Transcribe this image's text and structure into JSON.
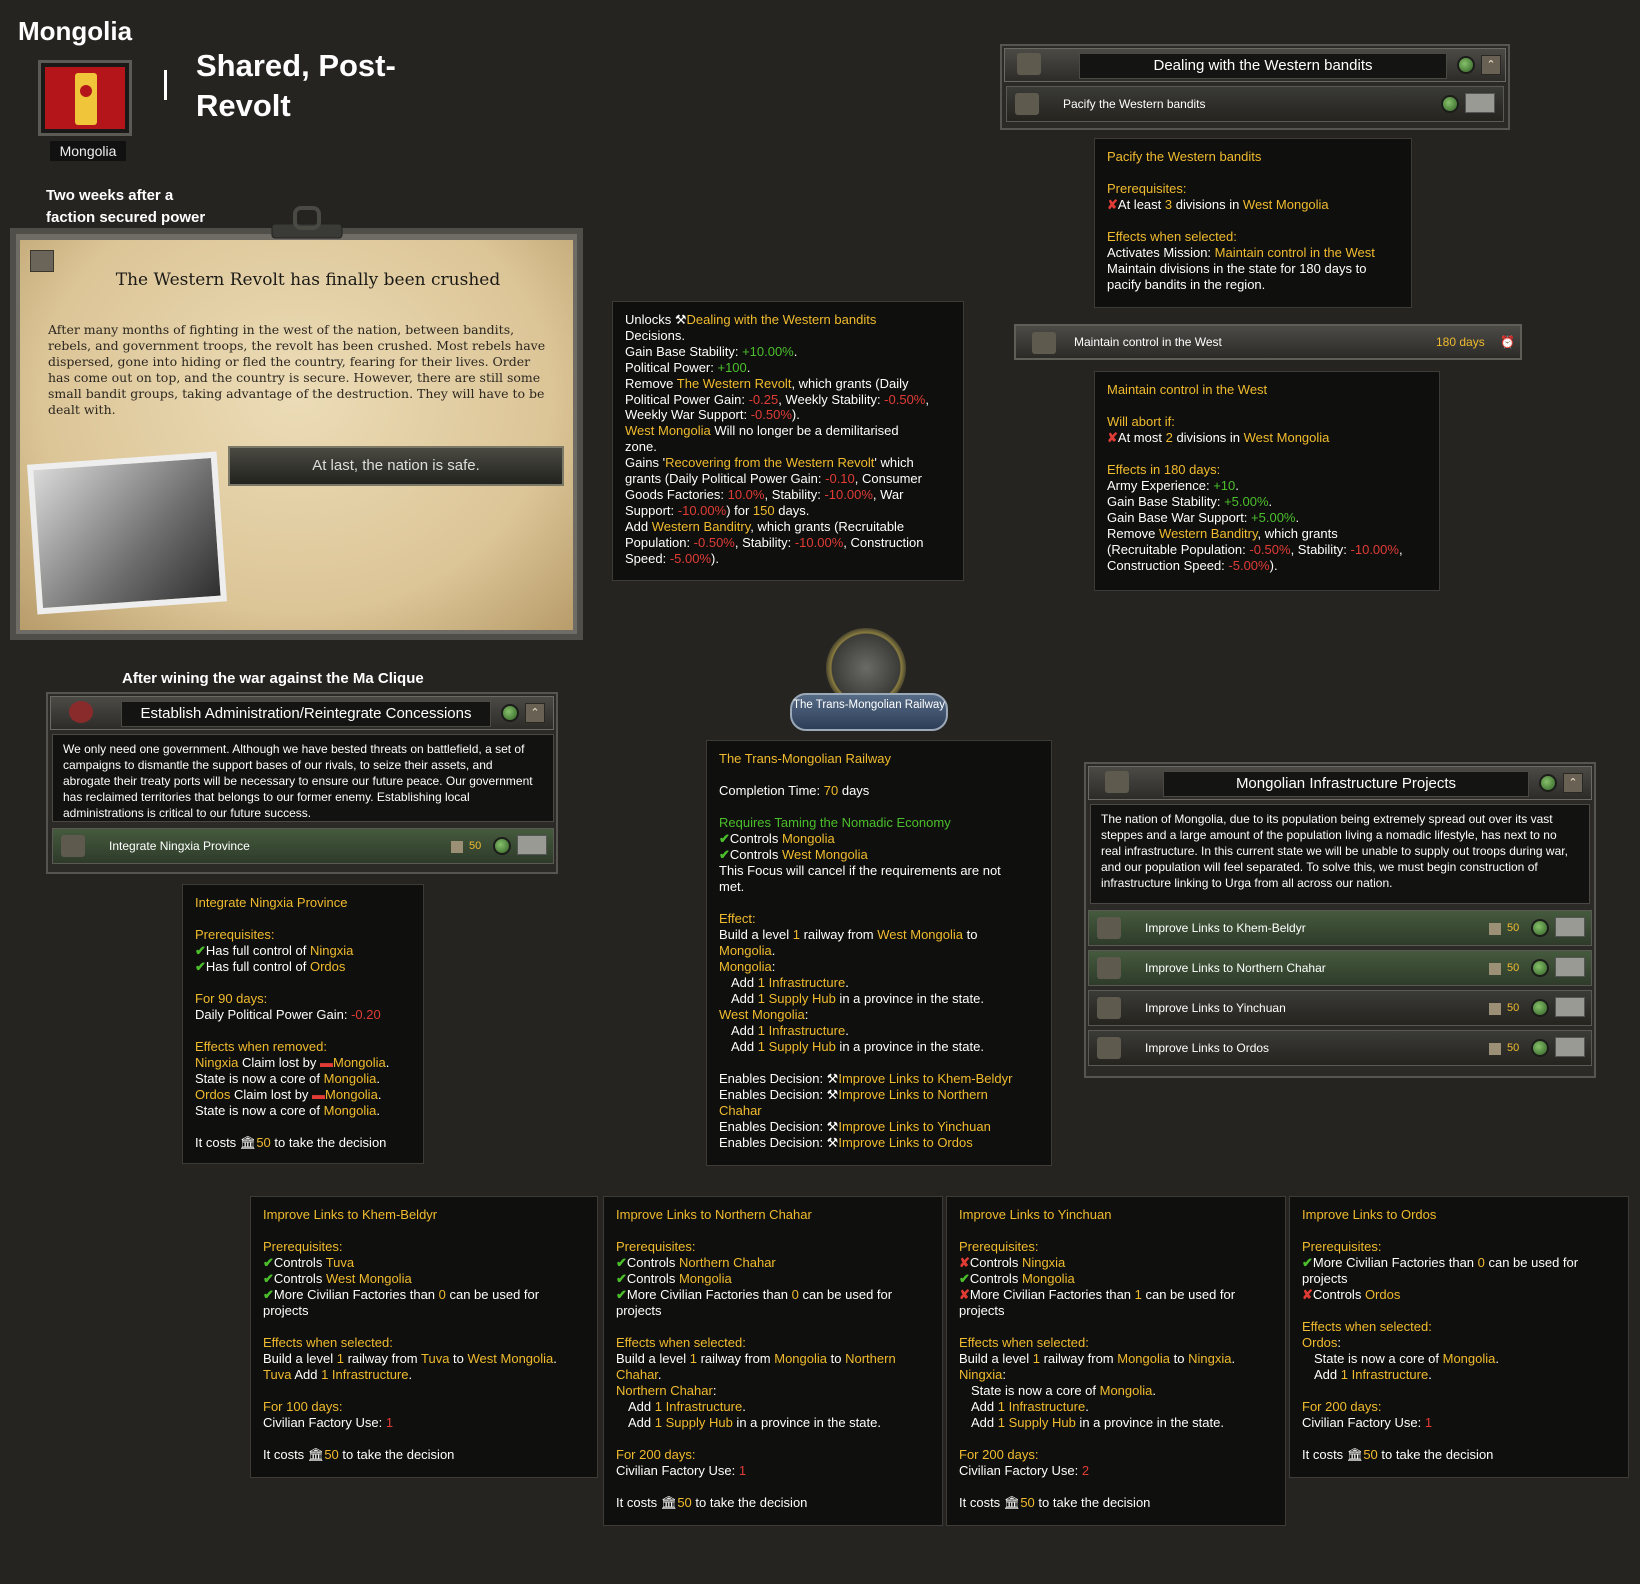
{
  "header": {
    "country": "Mongolia",
    "flag_label": "Mongolia",
    "separator": "|",
    "path_title": "Shared, Post-Revolt",
    "flag_colors": [
      "#b3151b",
      "#f1c53a"
    ]
  },
  "event": {
    "caption": "Two weeks after a faction secured power",
    "title": "The Western Revolt has finally been crushed",
    "text": "After many months of fighting in the west of the nation, between bandits, rebels, and government troops, the revolt has been crushed. Most rebels have dispersed, gone into hiding or fled the country, fearing for their lives. Order has come out on top, and the country is secure. However, there are still some small bandit groups, taking advantage of the destruction. They will have to be dealt with.",
    "option": "At last, the nation is safe."
  },
  "event_tooltip": {
    "l1a": "Unlocks ",
    "l1b": "Dealing with the Western bandits",
    "l2": "Decisions.",
    "l3a": "Gain Base Stability: ",
    "l3b": "+10.00%",
    "l3c": ".",
    "l4a": "Political Power: ",
    "l4b": "+100",
    "l4c": ".",
    "l5a": "Remove ",
    "l5b": "The Western Revolt",
    "l5c": ", which grants (Daily",
    "l6a": "Political Power Gain: ",
    "l6b": "-0.25",
    "l6c": ", Weekly Stability: ",
    "l6d": "-0.50%",
    "l6e": ",",
    "l7a": "Weekly War Support: ",
    "l7b": "-0.50%",
    "l7c": ").",
    "l8a": "West Mongolia",
    "l8b": " Will no longer be a demilitarised",
    "l9": "zone.",
    "l10a": "Gains '",
    "l10b": "Recovering from the Western Revolt",
    "l10c": "' which",
    "l11a": "grants (Daily Political Power Gain: ",
    "l11b": "-0.10",
    "l11c": ", Consumer",
    "l12a": "Goods Factories: ",
    "l12b": "10.0%",
    "l12c": ", Stability: ",
    "l12d": "-10.00%",
    "l12e": ", War",
    "l13a": "Support: ",
    "l13b": "-10.00%",
    "l13c": ") for ",
    "l13d": "150",
    "l13e": " days.",
    "l14a": "Add ",
    "l14b": "Western Banditry",
    "l14c": ", which grants (Recruitable",
    "l15a": "Population: ",
    "l15b": "-0.50%",
    "l15c": ", Stability: ",
    "l15d": "-10.00%",
    "l15e": ", Construction",
    "l16a": "Speed: ",
    "l16b": "-5.00%",
    "l16c": ")."
  },
  "bandits_panel": {
    "title": "Dealing with the Western bandits",
    "row": "Pacify the Western bandits"
  },
  "pacify_tt": {
    "title": "Pacify the Western bandits",
    "prereq": "Prerequisites:",
    "p1a": "At least ",
    "p1b": "3",
    "p1c": " divisions in ",
    "p1d": "West Mongolia",
    "eff": "Effects when selected:",
    "e1a": "Activates Mission: ",
    "e1b": "Maintain control in the West",
    "e2": "Maintain divisions in the state for 180 days to",
    "e3": "pacify bandits in the region."
  },
  "mission": {
    "label": "Maintain control in the West",
    "days": "180 days"
  },
  "maintain_tt": {
    "title": "Maintain control in the West",
    "abort": "Will abort if:",
    "a1a": "At most ",
    "a1b": "2",
    "a1c": " divisions in ",
    "a1d": "West Mongolia",
    "eff": "Effects in 180 days:",
    "e1a": "Army Experience: ",
    "e1b": "+10",
    "e1c": ".",
    "e2a": "Gain Base Stability: ",
    "e2b": "+5.00%",
    "e2c": ".",
    "e3a": "Gain Base War Support: ",
    "e3b": "+5.00%",
    "e3c": ".",
    "e4a": "Remove ",
    "e4b": "Western Banditry",
    "e4c": ", which grants",
    "e5a": "(Recruitable Population: ",
    "e5b": "-0.50%",
    "e5c": ", Stability: ",
    "e5d": "-10.00%",
    "e5e": ",",
    "e6a": "Construction Speed: ",
    "e6b": "-5.00%",
    "e6c": ")."
  },
  "admin": {
    "caption": "After wining the war against the Ma Clique",
    "title": "Establish Administration/Reintegrate Concessions",
    "desc": "We only need one government. Although we have bested threats on battlefield, a set of campaigns to dismantle the support bases of our rivals, to seize their assets, and abrogate their treaty ports will be necessary to ensure our future peace. Our government has reclaimed territories that belongs to our former enemy. Establishing local administrations is critical to our future success.",
    "row": "Integrate Ningxia Province",
    "cost": "50"
  },
  "ningxia_tt": {
    "title": "Integrate Ningxia Province",
    "prereq": "Prerequisites:",
    "p1a": "Has full control of ",
    "p1b": "Ningxia",
    "p2a": "Has full control of ",
    "p2b": "Ordos",
    "for": "For 90 days:",
    "f1a": "Daily Political Power Gain: ",
    "f1b": "-0.20",
    "rem": "Effects when removed:",
    "r1a": "Ningxia",
    "r1b": " Claim lost by ",
    "r1c": "Mongolia",
    "r1d": ".",
    "r2a": "State is now a core of ",
    "r2b": "Mongolia",
    "r2c": ".",
    "r3a": "Ordos",
    "r3b": " Claim lost by ",
    "r3c": "Mongolia",
    "r3d": ".",
    "r4a": "State is now a core of ",
    "r4b": "Mongolia",
    "r4c": ".",
    "costa": "It costs ",
    "costb": "50",
    "costc": " to take the decision"
  },
  "focus": {
    "name": "The Trans-Mongolian Railway"
  },
  "focus_tt": {
    "title": "The Trans-Mongolian Railway",
    "c1a": "Completion Time: ",
    "c1b": "70",
    "c1c": " days",
    "req": "Requires Taming the Nomadic Economy",
    "q1a": "Controls ",
    "q1b": "Mongolia",
    "q2a": "Controls ",
    "q2b": "West Mongolia",
    "cancel1": "This Focus will cancel if the requirements are not",
    "cancel2": "met.",
    "eff": "Effect:",
    "e1a": "Build a level ",
    "e1b": "1",
    "e1c": " railway from ",
    "e1d": "West Mongolia",
    "e1e": " to",
    "e2a": "Mongolia",
    "e2b": ".",
    "s1": "Mongolia",
    "s1c": ":",
    "s1a1a": "Add ",
    "s1a1b": "1",
    "s1a1c": " Infrastructure",
    "s1a1d": ".",
    "s1a2a": "Add ",
    "s1a2b": "1",
    "s1a2c": " Supply Hub",
    "s1a2d": " in a province in the state.",
    "s2": "West Mongolia",
    "s2c": ":",
    "s2a1a": "Add ",
    "s2a1b": "1",
    "s2a1c": " Infrastructure",
    "s2a1d": ".",
    "s2a2a": "Add ",
    "s2a2b": "1",
    "s2a2c": " Supply Hub",
    "s2a2d": " in a province in the state.",
    "en": "Enables Decision: ",
    "d1": "Improve Links to Khem-Beldyr",
    "d2a": "Improve Links to Northern",
    "d2b": "Chahar",
    "d3": "Improve Links to Yinchuan",
    "d4": "Improve Links to Ordos"
  },
  "infra": {
    "title": "Mongolian Infrastructure Projects",
    "desc": "The nation of Mongolia, due to its population being extremely spread out over its vast steppes and a large amount of the population living a nomadic lifestyle, has next to no real infrastructure. In this current state we will be unable to supply out troops during war, and our population will feel separated. To solve this, we must begin construction of infrastructure linking to Urga from all across our nation.",
    "rows": [
      {
        "label": "Improve Links to Khem-Beldyr",
        "cost": "50"
      },
      {
        "label": "Improve Links to Northern Chahar",
        "cost": "50"
      },
      {
        "label": "Improve Links to Yinchuan",
        "cost": "50"
      },
      {
        "label": "Improve Links to Ordos",
        "cost": "50"
      }
    ]
  },
  "khem_tt": {
    "title": "Improve Links to Khem-Beldyr",
    "prereq": "Prerequisites:",
    "p1a": "Controls ",
    "p1b": "Tuva",
    "p2a": "Controls ",
    "p2b": "West Mongolia",
    "p3a": "More Civilian Factories than ",
    "p3b": "0",
    "p3c": " can be used for",
    "p3d": "projects",
    "eff": "Effects when selected:",
    "e1a": "Build a level ",
    "e1b": "1",
    "e1c": " railway from ",
    "e1d": "Tuva",
    "e1e": " to ",
    "e1f": "West Mongolia",
    "e1g": ".",
    "e2a": "Tuva",
    "e2b": " Add ",
    "e2c": "1",
    "e2d": " Infrastructure",
    "e2e": ".",
    "for": "For 100 days:",
    "f1a": "Civilian Factory Use: ",
    "f1b": "1",
    "costa": "It costs ",
    "costb": "50",
    "costc": " to take the decision"
  },
  "chahar_tt": {
    "title": "Improve Links to Northern Chahar",
    "prereq": "Prerequisites:",
    "p1a": "Controls ",
    "p1b": "Northern Chahar",
    "p2a": "Controls ",
    "p2b": "Mongolia",
    "p3a": "More Civilian Factories than ",
    "p3b": "0",
    "p3c": " can be used for",
    "p3d": "projects",
    "eff": "Effects when selected:",
    "e1a": "Build a level ",
    "e1b": "1",
    "e1c": " railway from ",
    "e1d": "Mongolia",
    "e1e": " to ",
    "e1f": "Northern",
    "e1g": "Chahar",
    "e1h": ".",
    "s1": "Northern Chahar",
    "s1c": ":",
    "a1a": "Add ",
    "a1b": "1",
    "a1c": " Infrastructure",
    "a1d": ".",
    "a2a": "Add ",
    "a2b": "1",
    "a2c": " Supply Hub",
    "a2d": " in a province in the state.",
    "for": "For 200 days:",
    "f1a": "Civilian Factory Use: ",
    "f1b": "1",
    "costa": "It costs ",
    "costb": "50",
    "costc": " to take the decision"
  },
  "yinchuan_tt": {
    "title": "Improve Links to Yinchuan",
    "prereq": "Prerequisites:",
    "p1a": "Controls ",
    "p1b": "Ningxia",
    "p2a": "Controls ",
    "p2b": "Mongolia",
    "p3a": "More Civilian Factories than ",
    "p3b": "1",
    "p3c": " can be used for",
    "p3d": "projects",
    "eff": "Effects when selected:",
    "e1a": "Build a level ",
    "e1b": "1",
    "e1c": " railway from ",
    "e1d": "Mongolia",
    "e1e": " to ",
    "e1f": "Ningxia",
    "e1g": ".",
    "s1": "Ningxia",
    "s1c": ":",
    "a0a": "State is now a core of ",
    "a0b": "Mongolia",
    "a0c": ".",
    "a1a": "Add ",
    "a1b": "1",
    "a1c": " Infrastructure",
    "a1d": ".",
    "a2a": "Add ",
    "a2b": "1",
    "a2c": " Supply Hub",
    "a2d": " in a province in the state.",
    "for": "For 200 days:",
    "f1a": "Civilian Factory Use: ",
    "f1b": "2",
    "costa": "It costs ",
    "costb": "50",
    "costc": " to take the decision"
  },
  "ordos_tt": {
    "title": "Improve Links to Ordos",
    "prereq": "Prerequisites:",
    "p1a": "More Civilian Factories than ",
    "p1b": "0",
    "p1c": " can be used for",
    "p1d": "projects",
    "p2a": "Controls ",
    "p2b": "Ordos",
    "eff": "Effects when selected:",
    "s1": "Ordos",
    "s1c": ":",
    "a0a": "State is now a core of ",
    "a0b": "Mongolia",
    "a0c": ".",
    "a1a": "Add ",
    "a1b": "1",
    "a1c": " Infrastructure",
    "a1d": ".",
    "for": "For 200 days:",
    "f1a": "Civilian Factory Use: ",
    "f1b": "1",
    "costa": "It costs ",
    "costb": "50",
    "costc": " to take the decision"
  },
  "glyphs": {
    "check": "✔",
    "cross": "✘",
    "up": "⌃"
  }
}
